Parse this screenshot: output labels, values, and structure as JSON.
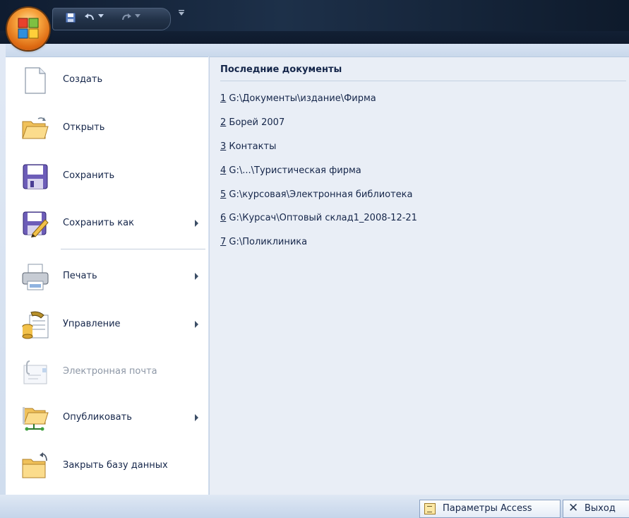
{
  "quick_access": {
    "save_icon": "save-icon",
    "undo_icon": "undo-icon",
    "redo_icon": "redo-icon",
    "customize_icon": "customize-qat-icon"
  },
  "menu": {
    "items": [
      {
        "label": "Создать",
        "icon": "new-document-icon",
        "submenu": false,
        "enabled": true
      },
      {
        "label": "Открыть",
        "icon": "open-folder-icon",
        "submenu": false,
        "enabled": true
      },
      {
        "label": "Сохранить",
        "icon": "save-disk-icon",
        "submenu": false,
        "enabled": true
      },
      {
        "label": "Сохранить как",
        "icon": "save-as-icon",
        "submenu": true,
        "enabled": true
      },
      {
        "label": "Печать",
        "icon": "printer-icon",
        "submenu": true,
        "enabled": true
      },
      {
        "label": "Управление",
        "icon": "manage-database-icon",
        "submenu": true,
        "enabled": true
      },
      {
        "label": "Электронная почта",
        "icon": "email-icon",
        "submenu": false,
        "enabled": false
      },
      {
        "label": "Опубликовать",
        "icon": "publish-icon",
        "submenu": true,
        "enabled": true
      },
      {
        "label": "Закрыть базу данных",
        "icon": "close-database-icon",
        "submenu": false,
        "enabled": true
      }
    ]
  },
  "recent": {
    "title": "Последние документы",
    "items": [
      {
        "num": "1",
        "path": "G:\\Документы\\издание\\Фирма"
      },
      {
        "num": "2",
        "path": "Борей 2007"
      },
      {
        "num": "3",
        "path": "Контакты"
      },
      {
        "num": "4",
        "path": "G:\\...\\Туристическая фирма"
      },
      {
        "num": "5",
        "path": "G:\\курсовая\\Электронная библиотека"
      },
      {
        "num": "6",
        "path": "G:\\Курсач\\Оптовый склад1_2008-12-21"
      },
      {
        "num": "7",
        "path": "G:\\Поликлиника"
      }
    ]
  },
  "footer": {
    "options_label": "Параметры Access",
    "exit_label": "Выход"
  }
}
